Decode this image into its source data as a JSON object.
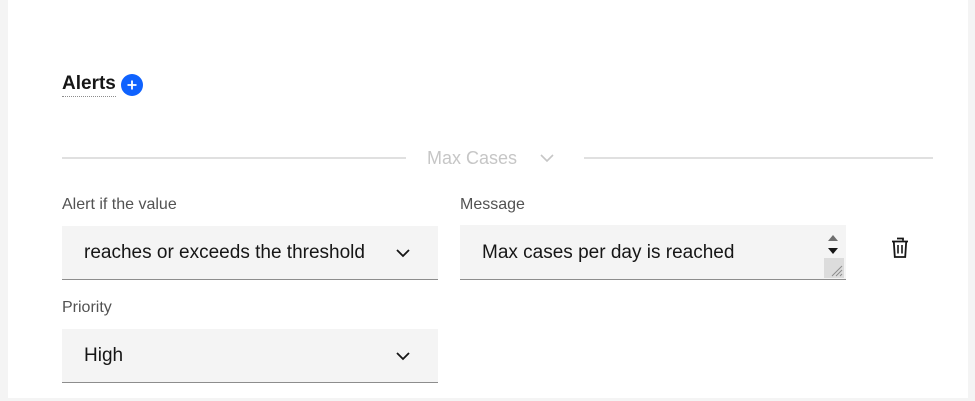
{
  "alerts": {
    "title": "Alerts",
    "add_icon": "add-circle-icon",
    "accent_color": "#0f62fe"
  },
  "section": {
    "label": "Max Cases",
    "chevron_icon": "chevron-down-icon"
  },
  "condition": {
    "label": "Alert if the value",
    "value": "reaches or exceeds the threshold"
  },
  "message": {
    "label": "Message",
    "value": "Max cases per day is reached"
  },
  "priority": {
    "label": "Priority",
    "value": "High"
  },
  "delete": {
    "icon": "trash-icon"
  }
}
